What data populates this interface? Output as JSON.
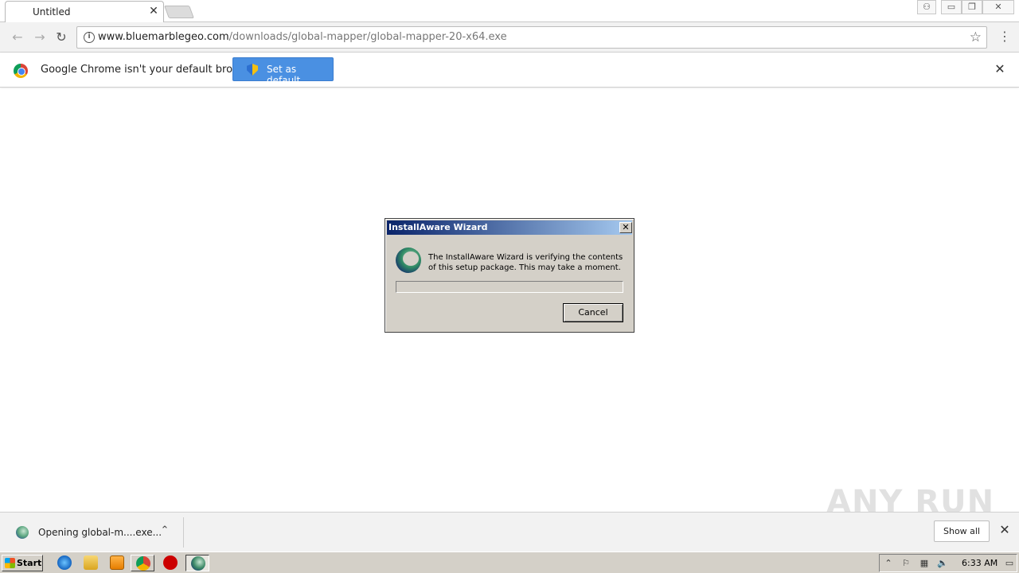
{
  "browser": {
    "tab_title": "Untitled",
    "url_host": "www.bluemarblegeo.com",
    "url_path": "/downloads/global-mapper/global-mapper-20-x64.exe"
  },
  "infobar": {
    "message": "Google Chrome isn't your default browser",
    "button_label": "Set as default"
  },
  "dialog": {
    "title": "InstallAware Wizard",
    "message": "The InstallAware Wizard is verifying the contents of this setup package. This may take a moment.",
    "progress": 0,
    "cancel_label": "Cancel"
  },
  "download_shelf": {
    "item_name": "Opening global-m....exe...",
    "show_all_label": "Show all"
  },
  "watermark": "ANY RUN",
  "taskbar": {
    "start_label": "Start",
    "clock": "6:33 AM"
  },
  "colors": {
    "accent": "#4a90e2",
    "dialog_title_start": "#0a246a",
    "dialog_title_end": "#a6caf0",
    "classic_face": "#d4d0c8"
  }
}
